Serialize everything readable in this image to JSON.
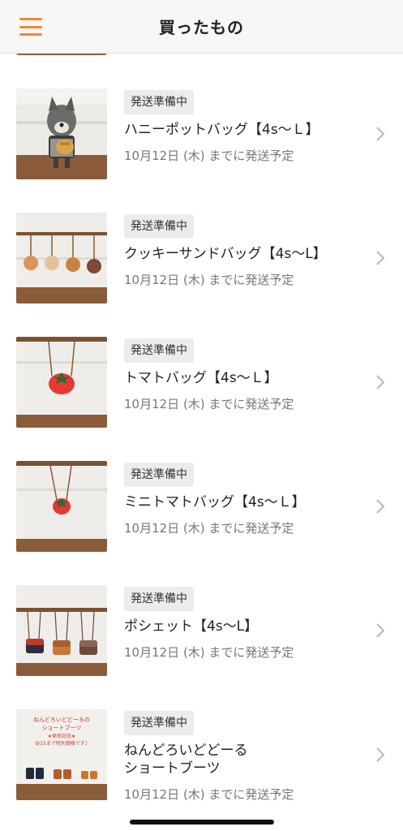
{
  "header": {
    "title": "買ったもの",
    "menu_icon": "hamburger-menu-icon",
    "accent_color": "#f08a2c"
  },
  "orders": [
    {
      "status": "発送準備中",
      "title": "ハニーポットバッグ【4s～Ｌ】",
      "due": "10月12日 (木) までに発送予定",
      "thumb_text": ""
    },
    {
      "status": "発送準備中",
      "title": "クッキーサンドバッグ【4s～L】",
      "due": "10月12日 (木) までに発送予定",
      "thumb_text": ""
    },
    {
      "status": "発送準備中",
      "title": "トマトバッグ【4s～Ｌ】",
      "due": "10月12日 (木) までに発送予定",
      "thumb_text": ""
    },
    {
      "status": "発送準備中",
      "title": "ミニトマトバッグ【4s～Ｌ】",
      "due": "10月12日 (木) までに発送予定",
      "thumb_text": ""
    },
    {
      "status": "発送準備中",
      "title": "ポシェット【4s～L】",
      "due": "10月12日 (木) までに発送予定",
      "thumb_text": ""
    },
    {
      "status": "発送準備中",
      "title": "ねんどろいどどーる\nショートブーツ",
      "due": "10月12日 (木) までに発送予定",
      "thumb_text": [
        "ねんどろいどどーるの",
        "ショートブーツ",
        "★発売記念★",
        "9/15まで特別価格です♪"
      ]
    }
  ],
  "chevron_icon": "chevron-right-icon"
}
